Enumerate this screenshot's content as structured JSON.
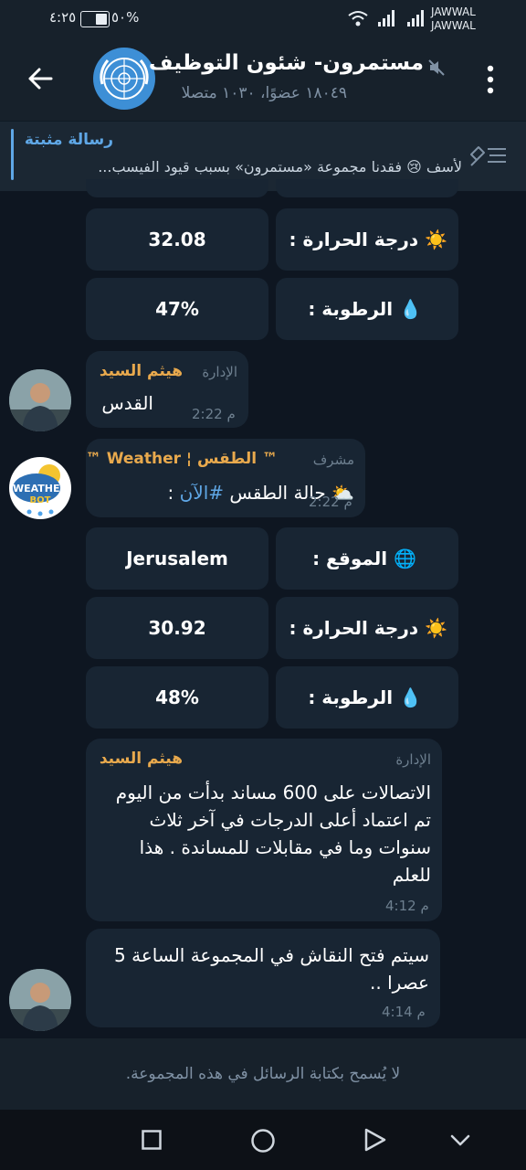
{
  "status_bar": {
    "time": "٤:٢٥",
    "battery": "٥٠%",
    "carrier1": "JAWWAL",
    "carrier2": "JAWWAL"
  },
  "header": {
    "title": "مستمرون- شئون التوظيف",
    "subtitle": "١٨٠٤٩ عضوًا، ١٠٣٠ متصلا"
  },
  "pinned": {
    "title": "رسالة مثبتة",
    "text": "لأسف 😢 فقدنا مجموعة «مستمرون» بسبب قيود الفيسب..."
  },
  "weather_top": {
    "temp_label": "☀️ درجة الحرارة  :",
    "temp_value": "32.08",
    "humidity_label": "💧 الرطوبة :",
    "humidity_value": "47%"
  },
  "msg1": {
    "name": "هيثم السيد",
    "role": "الإدارة",
    "text": "القدس",
    "time": "2:22 م"
  },
  "msg2": {
    "name": "™ الطقس ¦ Weather ™",
    "role": "مشرف",
    "text_prefix": "⛅ حالة الطقس ",
    "hashtag": "#الآن",
    "text_suffix": " :",
    "time": "2:22 م",
    "avatar_text1": "WEATHER",
    "avatar_text2": "BOT"
  },
  "weather_bottom": {
    "location_label": "🌐 الموقع :",
    "location_value": "Jerusalem",
    "temp_label": "☀️ درجة الحرارة  :",
    "temp_value": "30.92",
    "humidity_label": "💧 الرطوبة :",
    "humidity_value": "48%"
  },
  "msg3": {
    "name": "هيثم السيد",
    "role": "الإدارة",
    "text": "الاتصالات على 600 مساند بدأت من اليوم تم اعتماد أعلى الدرجات في آخر ثلاث سنوات وما في مقابلات للمساندة . هذا للعلم",
    "time": "4:12 م"
  },
  "msg4": {
    "text": "سيتم فتح النقاش في المجموعة الساعة 5 عصرا ..",
    "time": "4:14 م"
  },
  "footer": {
    "text": "لا يُسمح بكتابة الرسائل في هذه المجموعة."
  },
  "icons": {
    "back": "back-arrow-icon",
    "more": "more-vertical-icon",
    "mute": "mute-icon",
    "pin_list": "pin-list-icon"
  }
}
